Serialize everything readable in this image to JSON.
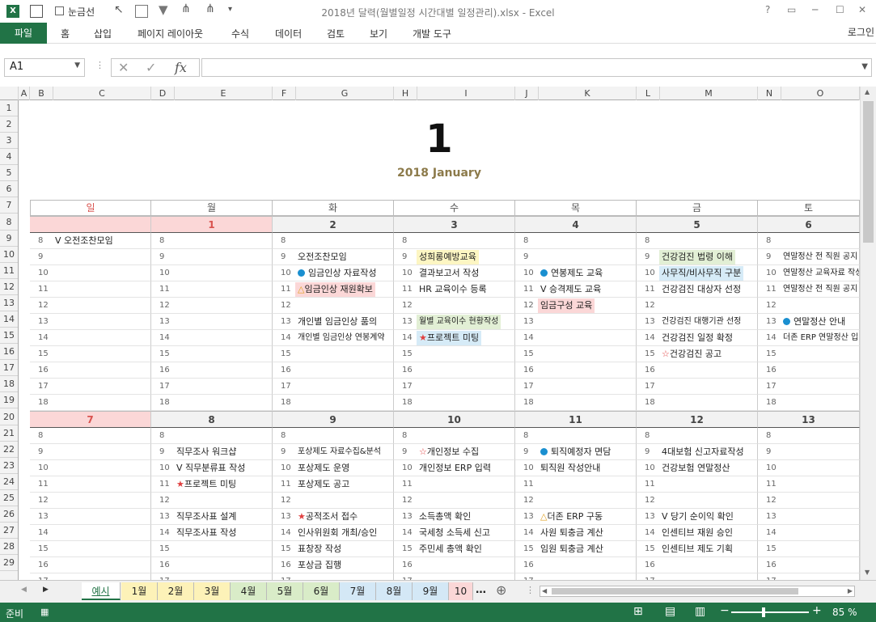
{
  "window": {
    "title": "2018년 달력(월별일정 시간대별 일정관리).xlsx - Excel",
    "help": "?",
    "login": "로그인"
  },
  "qat": {
    "gridlines_label": "눈금선"
  },
  "ribbon": {
    "tabs": [
      "파일",
      "홈",
      "삽입",
      "페이지 레이아웃",
      "수식",
      "데이터",
      "검토",
      "보기",
      "개발 도구"
    ]
  },
  "namebox": "A1",
  "fx": "fx",
  "columns": [
    "A",
    "B",
    "C",
    "D",
    "E",
    "F",
    "G",
    "H",
    "I",
    "J",
    "K",
    "L",
    "M",
    "N",
    "O"
  ],
  "rows": [
    "1",
    "2",
    "3",
    "4",
    "5",
    "6",
    "7",
    "8",
    "9",
    "10",
    "11",
    "12",
    "13",
    "14",
    "15",
    "16",
    "17",
    "18",
    "19",
    "20",
    "21",
    "22",
    "23",
    "24",
    "25",
    "26",
    "27",
    "28",
    "29"
  ],
  "calendar": {
    "month": "1",
    "subtitle": "2018 January",
    "weekdays": [
      "일",
      "월",
      "화",
      "수",
      "목",
      "금",
      "토"
    ],
    "hours": [
      "8",
      "9",
      "10",
      "11",
      "12",
      "13",
      "14",
      "15",
      "16",
      "17",
      "18"
    ],
    "week1": {
      "dates": [
        "",
        "1",
        "2",
        "3",
        "4",
        "5",
        "6"
      ],
      "events": [
        [
          "V 오전조찬모임",
          "",
          "",
          "",
          "",
          "",
          "",
          "",
          "",
          "",
          ""
        ],
        [
          "",
          "",
          "",
          "",
          "",
          "",
          "",
          "",
          "",
          "",
          ""
        ],
        [
          "",
          "오전조찬모임",
          "● 임금인상 자료작성",
          "△임금인상 재원확보",
          "",
          "개인별 임금인상 품의",
          "개인별 임금인상 연봉계약",
          "",
          "",
          "",
          ""
        ],
        [
          "",
          "성희롱예방교육",
          "결과보고서 작성",
          "HR 교육이수 등록",
          "",
          "월별 교육이수 현황작성",
          "★프로젝트 미팅",
          "",
          "",
          "",
          ""
        ],
        [
          "",
          "",
          "● 연봉제도 교육",
          "V 승격제도 교육",
          "임금구성 교육",
          "",
          "",
          "",
          "",
          "",
          ""
        ],
        [
          "",
          "건강검진 법령 이해",
          "사무직/비사무직 구분",
          "건강검진 대상자 선정",
          "",
          "건강검진 대행기관 선정",
          "건강검진 일정 확정",
          "☆건강검진 공고",
          "",
          "",
          ""
        ],
        [
          "",
          "연말정산 전 직원 공지",
          "연말정산 교육자료 작성",
          "연말정산 전 직원 공지",
          "",
          "● 연말정산 안내",
          "더존 ERP 연말정산 입력",
          "",
          "",
          "",
          ""
        ]
      ]
    },
    "week2": {
      "dates": [
        "7",
        "8",
        "9",
        "10",
        "11",
        "12",
        "13"
      ],
      "events": [
        [
          "",
          "",
          "",
          "",
          "",
          "",
          "",
          "",
          "",
          ""
        ],
        [
          "",
          "직무조사 워크샵",
          "V 직무분류표 작성",
          "★프로젝트 미팅",
          "",
          "직무조사표 설계",
          "직무조사표 작성",
          "",
          ""
        ],
        [
          "",
          "포상제도 자료수집&분석",
          "포상제도 운영",
          "포상제도 공고",
          "",
          "★공적조서 접수",
          "인사위원회 개최/승인",
          "표창장 작성",
          "포상금 집행"
        ],
        [
          "",
          "☆개인정보 수집",
          "개인정보 ERP 입력",
          "",
          "",
          "소득총액 확인",
          "국세청 소득세 신고",
          "주민세 총액 확인",
          ""
        ],
        [
          "",
          "● 퇴직예정자 면담",
          "퇴직원 작성안내",
          "",
          "",
          "△더존 ERP 구동",
          "사원 퇴충금 계산",
          "임원 퇴충금 계산",
          ""
        ],
        [
          "",
          "4대보험 신고자료작성",
          "건강보험 연말정산",
          "",
          "",
          "V 당기 순이익 확인",
          "인센티브 재원 승인",
          "인센티브 제도 기획",
          ""
        ],
        [
          "",
          "",
          "",
          "",
          "",
          "",
          "",
          "",
          ""
        ]
      ]
    }
  },
  "sheet_tabs": [
    "예시",
    "1월",
    "2월",
    "3월",
    "4월",
    "5월",
    "6월",
    "7월",
    "8월",
    "9월",
    "10"
  ],
  "status": {
    "ready": "준비",
    "zoom": "85 %"
  },
  "colors": {
    "excel_green": "#217346",
    "sunday_red": "#d9534f",
    "sunday_fill": "#fbd7d7",
    "title_gold": "#8c7a4a",
    "blue_dot": "#1a8fd0"
  }
}
